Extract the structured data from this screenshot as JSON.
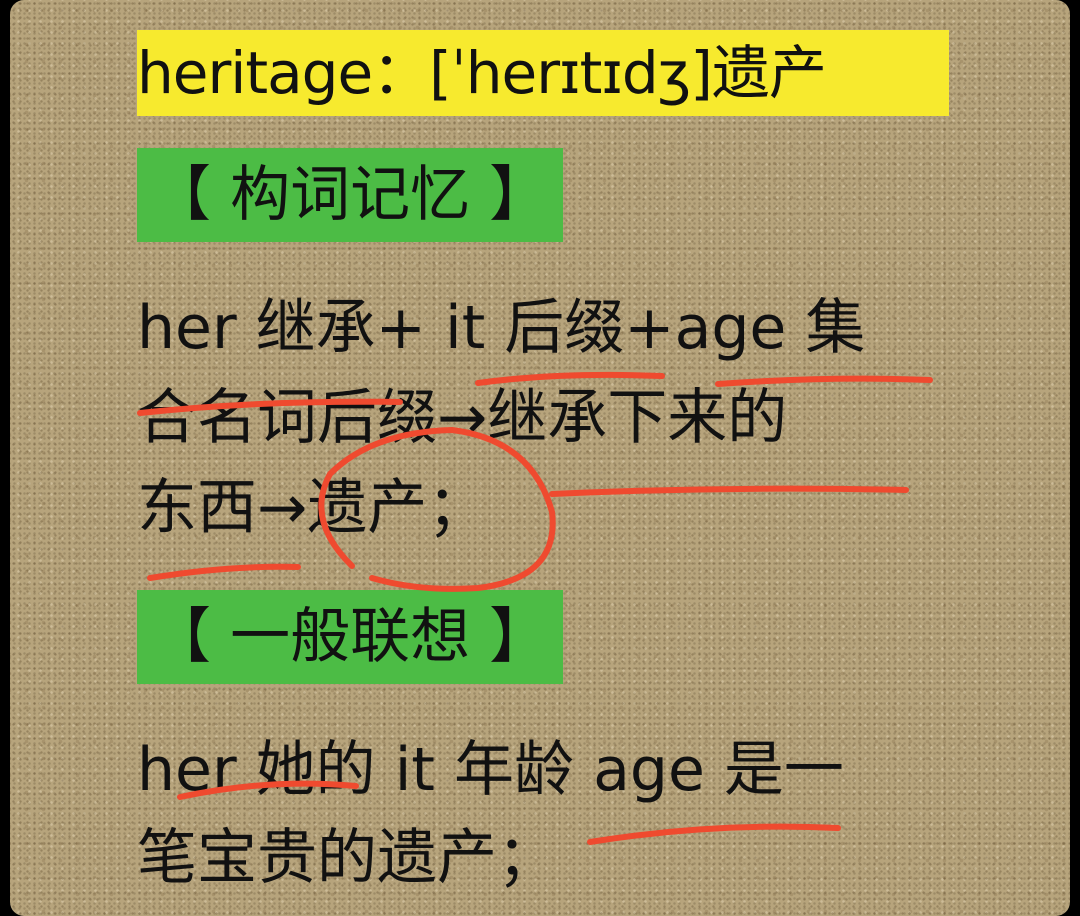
{
  "title": "heritage：[ˈherɪtɪdʒ]遗产",
  "sections": [
    {
      "heading": "【 构词记忆 】",
      "lines": [
        "her 继承+ it 后缀+age 集",
        "合名词后缀→继承下来的",
        "东西→遗产；"
      ]
    },
    {
      "heading": "【 一般联想 】",
      "lines": [
        "her 她的 it 年龄 age 是一",
        "笔宝贵的遗产；"
      ]
    }
  ],
  "colors": {
    "title_highlight": "#f7ea2e",
    "heading_highlight": "#4cbc45",
    "annotation": "#ef4a2f",
    "background": "#b7a47c"
  }
}
